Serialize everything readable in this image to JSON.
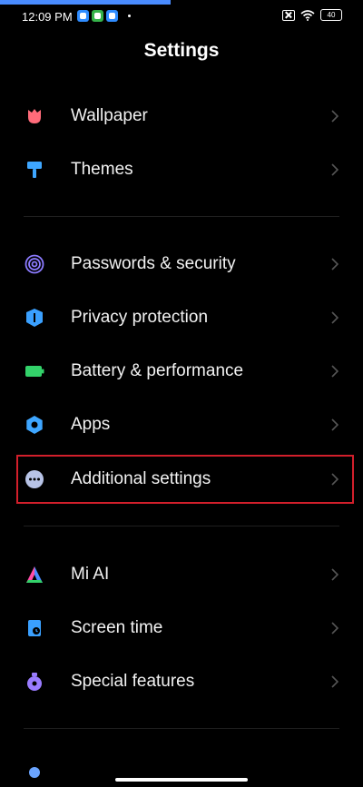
{
  "status_bar": {
    "time": "12:09 PM",
    "battery": "40",
    "icons": [
      "notification-app-icon",
      "notification-app-icon",
      "notification-app-icon",
      "no-sim-icon",
      "wifi-icon",
      "battery-icon"
    ]
  },
  "header": {
    "title": "Settings"
  },
  "groups": [
    [
      {
        "id": "wallpaper",
        "label": "Wallpaper",
        "icon": "tulip-icon",
        "color": "#ff6b7a"
      },
      {
        "id": "themes",
        "label": "Themes",
        "icon": "paint-roller-icon",
        "color": "#3ea6ff"
      }
    ],
    [
      {
        "id": "passwords-security",
        "label": "Passwords & security",
        "icon": "fingerprint-icon",
        "color": "#8c7bff"
      },
      {
        "id": "privacy-protection",
        "label": "Privacy protection",
        "icon": "shield-icon",
        "color": "#3aa0ff"
      },
      {
        "id": "battery-performance",
        "label": "Battery & performance",
        "icon": "battery-icon",
        "color": "#33d26a"
      },
      {
        "id": "apps",
        "label": "Apps",
        "icon": "gear-icon",
        "color": "#3ea6ff"
      },
      {
        "id": "additional-settings",
        "label": "Additional settings",
        "icon": "more-dots-icon",
        "color": "#b7c3e6",
        "highlighted": true
      }
    ],
    [
      {
        "id": "mi-ai",
        "label": "Mi AI",
        "icon": "mi-ai-icon",
        "color": "#4a8cff"
      },
      {
        "id": "screen-time",
        "label": "Screen time",
        "icon": "hourglass-icon",
        "color": "#3aa0ff"
      },
      {
        "id": "special-features",
        "label": "Special features",
        "icon": "potion-icon",
        "color": "#9a7cff"
      }
    ]
  ],
  "highlight": {
    "color": "#d21f2b"
  }
}
